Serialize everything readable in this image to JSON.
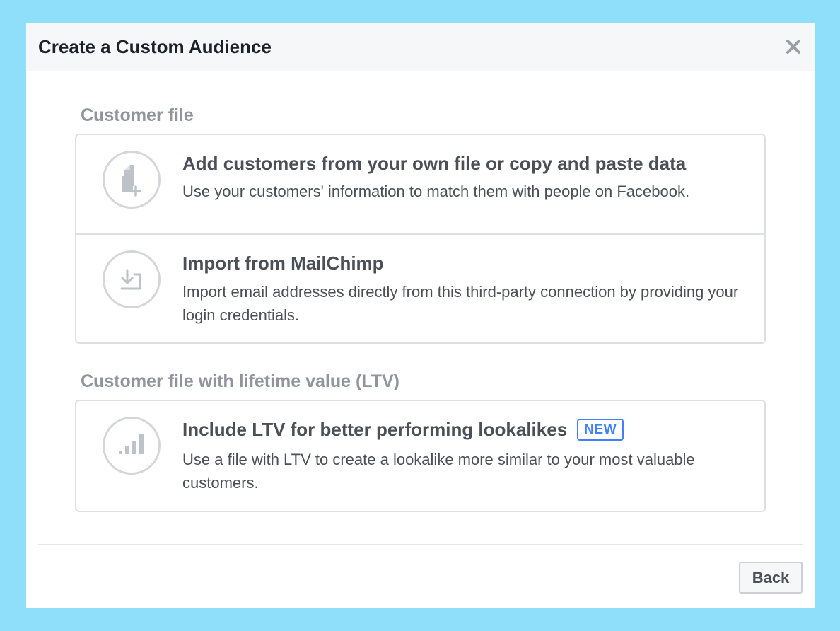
{
  "dialog": {
    "title": "Create a Custom Audience",
    "close_icon": "close-icon"
  },
  "sections": [
    {
      "label": "Customer file",
      "options": [
        {
          "icon": "file-add-icon",
          "title": "Add customers from your own file or copy and paste data",
          "description": "Use your customers' information to match them with people on Facebook."
        },
        {
          "icon": "import-icon",
          "title": "Import from MailChimp",
          "description": "Import email addresses directly from this third-party connection by providing your login credentials."
        }
      ]
    },
    {
      "label": "Customer file with lifetime value (LTV)",
      "options": [
        {
          "icon": "bar-chart-icon",
          "title": "Include LTV for better performing lookalikes",
          "badge": "NEW",
          "description": "Use a file with LTV to create a lookalike more similar to your most valuable customers."
        }
      ]
    }
  ],
  "footer": {
    "back_label": "Back"
  },
  "colors": {
    "backdrop": "#8fdffb",
    "header_bg": "#f6f7f9",
    "badge": "#4080ff",
    "section_label": "#90949c",
    "text": "#4b4f56"
  }
}
